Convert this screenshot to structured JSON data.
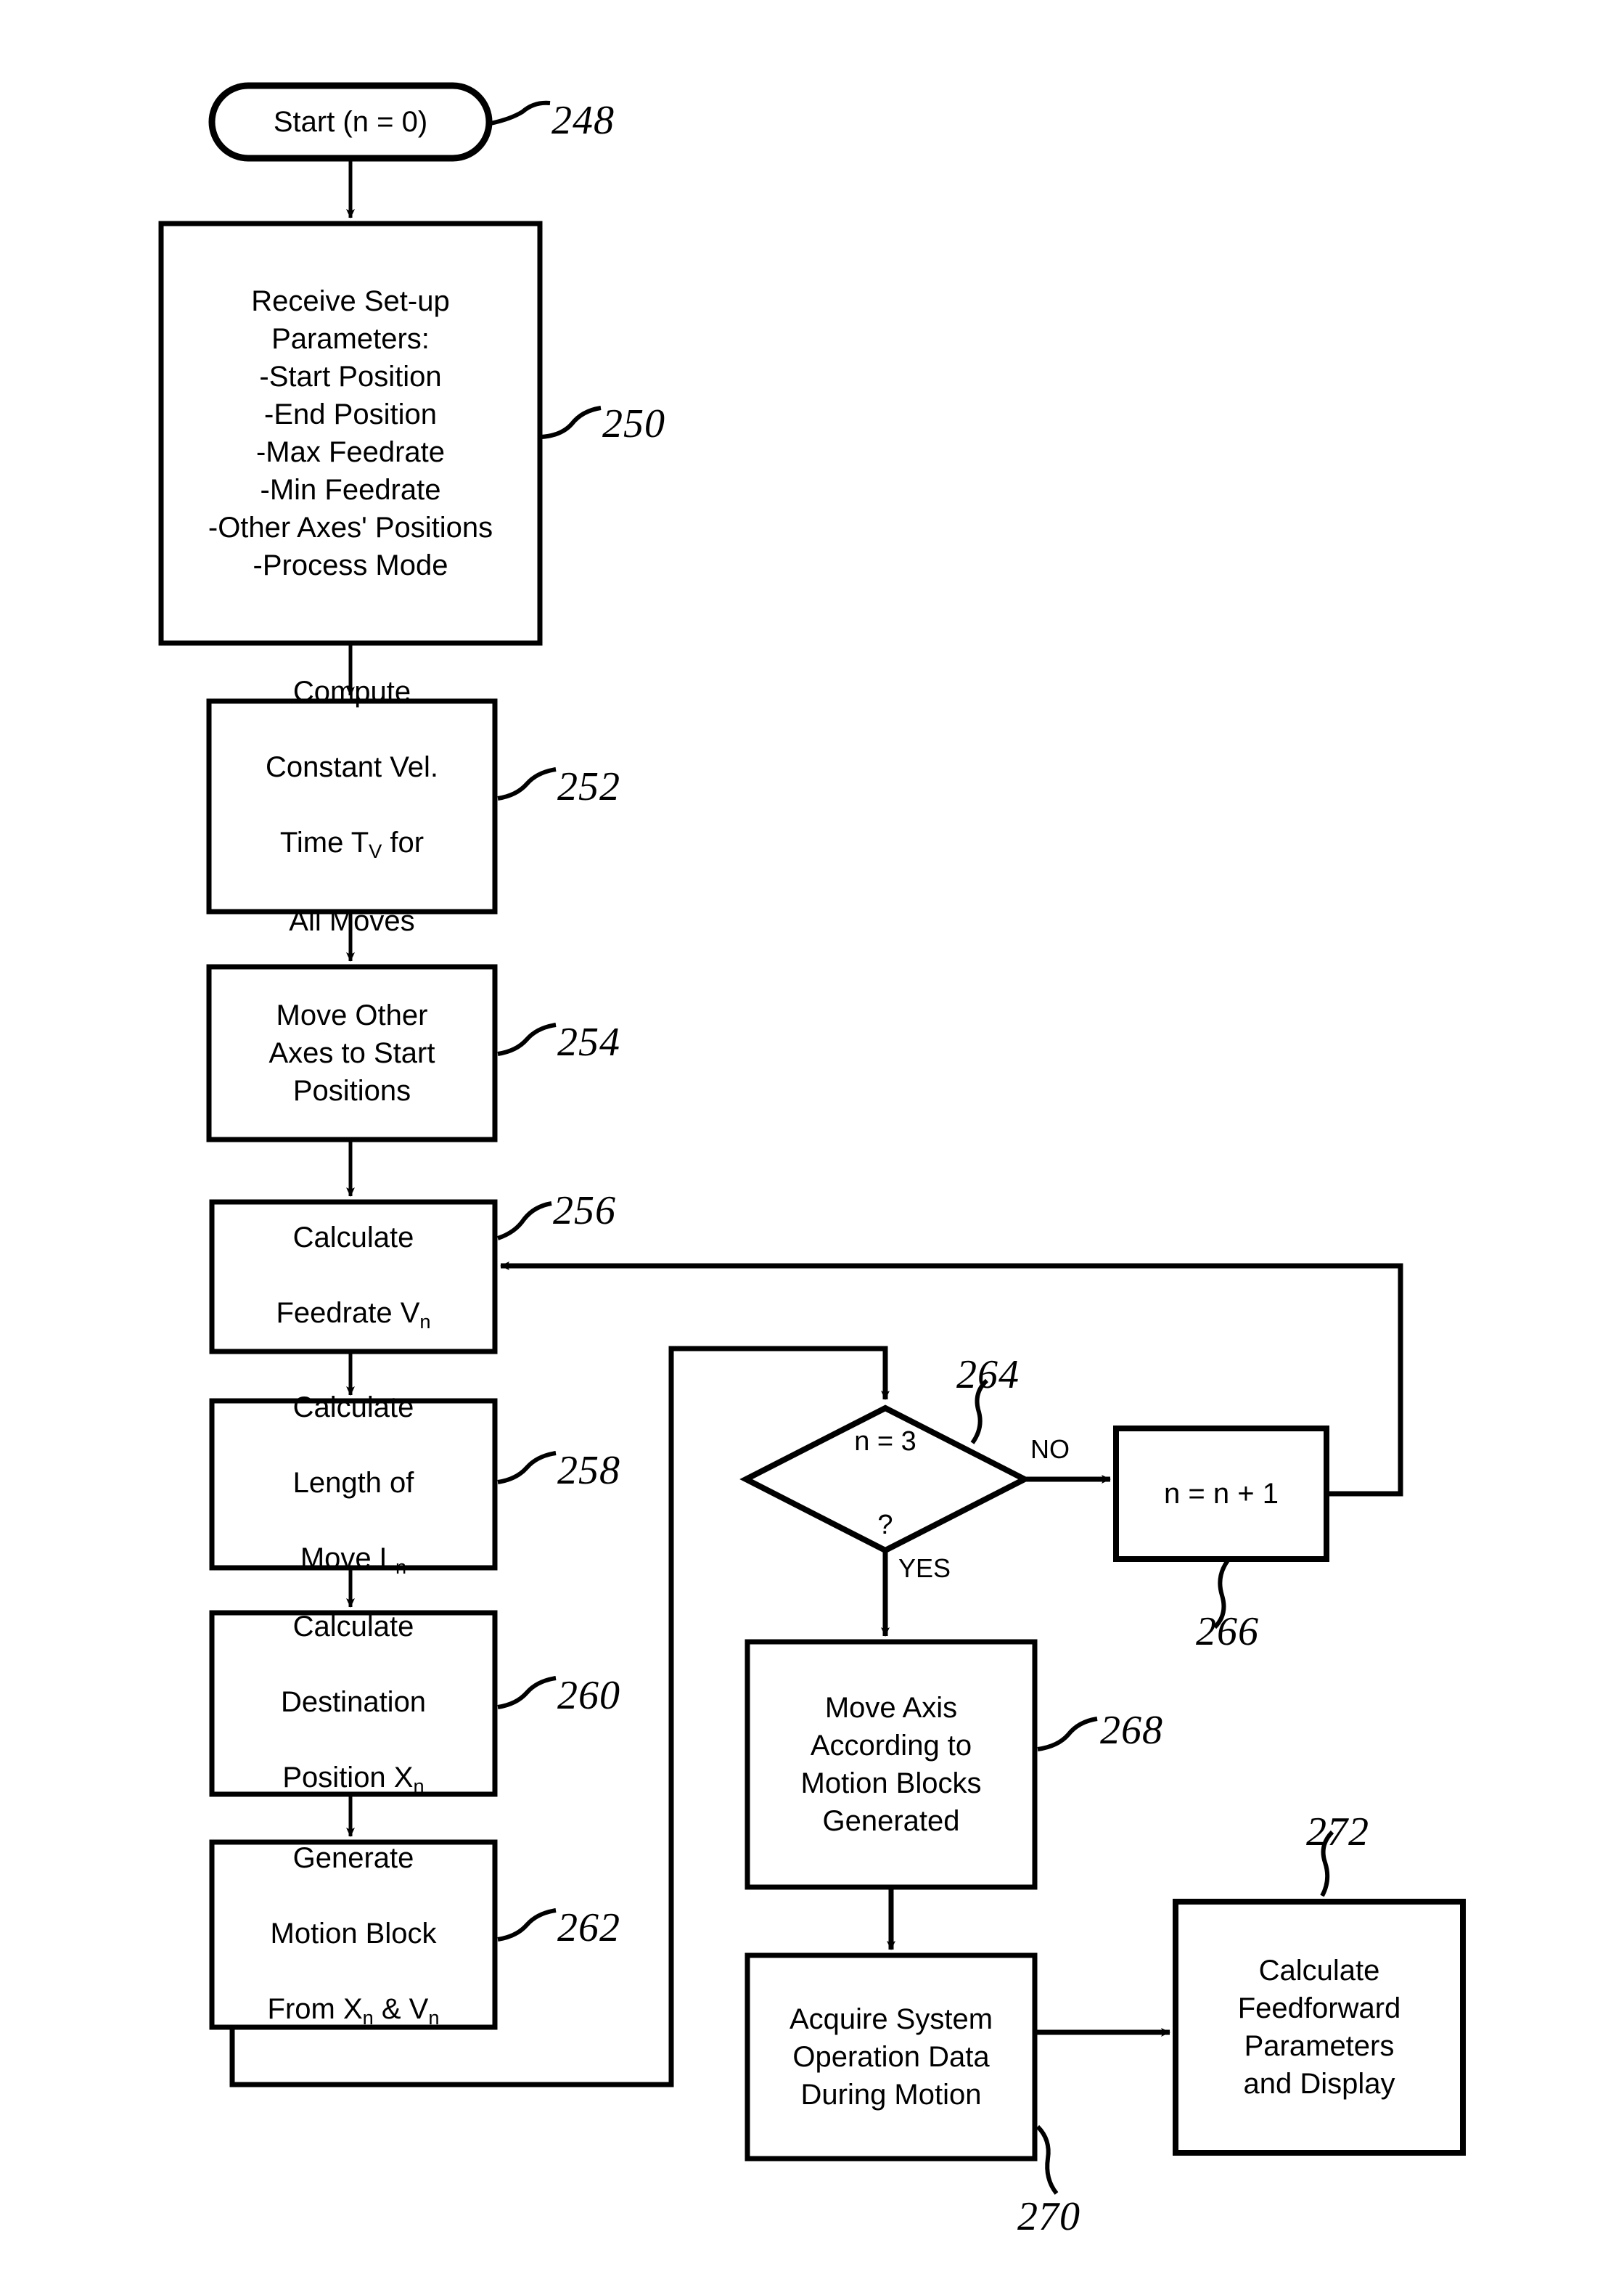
{
  "figure": {
    "type": "process-flowchart",
    "background_color": "#ffffff",
    "line_color": "#000000"
  },
  "nodes": {
    "start": {
      "ref": "248",
      "shape": "stadium",
      "label": "Start (n = 0)"
    },
    "receive_setup": {
      "ref": "250",
      "shape": "rectangle",
      "label": "Receive Set-up\nParameters:\n-Start Position\n-End Position\n-Max Feedrate\n-Min Feedrate\n-Other Axes' Positions\n-Process Mode"
    },
    "compute_const_vel": {
      "ref": "252",
      "shape": "rectangle",
      "label_line1": "Compute",
      "label_line2": "Constant Vel.",
      "label_line3_pre": "Time T",
      "label_line3_sub": "V",
      "label_line3_post": " for",
      "label_line4": "All Moves"
    },
    "move_other_axes": {
      "ref": "254",
      "shape": "rectangle",
      "label": "Move Other\nAxes to Start\nPositions"
    },
    "calc_feedrate": {
      "ref": "256",
      "shape": "rectangle",
      "label_line1": "Calculate",
      "label_line2_pre": "Feedrate V",
      "label_line2_sub": "n"
    },
    "calc_length": {
      "ref": "258",
      "shape": "rectangle",
      "label_line1": "Calculate",
      "label_line2": "Length of",
      "label_line3_pre": "Move L",
      "label_line3_sub": "n"
    },
    "calc_destination": {
      "ref": "260",
      "shape": "rectangle",
      "label_line1": "Calculate",
      "label_line2": "Destination",
      "label_line3_pre": "Position X",
      "label_line3_sub": "n"
    },
    "generate_motion_block": {
      "ref": "262",
      "shape": "rectangle",
      "label_line1": "Generate",
      "label_line2": "Motion Block",
      "label_line3_pre": "From X",
      "label_line3_sub1": "n",
      "label_line3_mid": " & V",
      "label_line3_sub2": "n"
    },
    "decision_n3": {
      "ref": "264",
      "shape": "diamond",
      "label_line1": "n = 3",
      "label_line2": "?"
    },
    "increment_n": {
      "ref": "266",
      "shape": "rectangle",
      "label": "n = n + 1"
    },
    "move_axis": {
      "ref": "268",
      "shape": "rectangle",
      "label": "Move Axis\nAccording to\nMotion Blocks\nGenerated"
    },
    "acquire_data": {
      "ref": "270",
      "shape": "rectangle",
      "label": "Acquire System\nOperation Data\nDuring Motion"
    },
    "calc_feedforward": {
      "ref": "272",
      "shape": "rectangle",
      "label": "Calculate\nFeedforward\nParameters\nand Display"
    }
  },
  "edge_labels": {
    "no": "NO",
    "yes": "YES"
  }
}
